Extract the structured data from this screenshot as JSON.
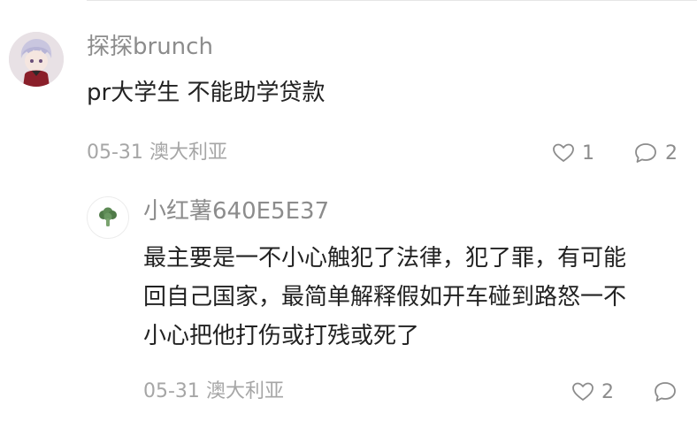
{
  "main_comment": {
    "username": "探探brunch",
    "text": "pr大学生 不能助学贷款",
    "date": "05-31",
    "location": "澳大利亚",
    "likes": "1",
    "replies": "2",
    "avatar_icon": "anime-avatar-icon"
  },
  "reply": {
    "username": "小红薯640E5E37",
    "text_lines": [
      "最主要是一不小心触犯了法律，犯了罪，有可能",
      "回自己国家，最简单解释假如开车碰到路怒一不",
      "小心把他打伤或打残或死了"
    ],
    "date": "05-31",
    "location": "澳大利亚",
    "likes": "2",
    "avatar_icon": "broccoli-avatar-icon"
  },
  "colors": {
    "primary_text": "#222222",
    "secondary_text": "#8c8c8c",
    "meta_text": "#a6a6a6",
    "icon_stroke": "#8c8c8c"
  }
}
